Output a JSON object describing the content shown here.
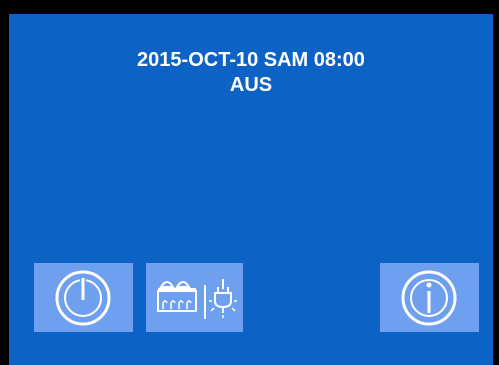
{
  "status": {
    "datetime": "2015-OCT-10 SAM 08:00",
    "state": "AUS"
  },
  "buttons": [
    {
      "name": "power-button",
      "icon": "power-icon"
    },
    {
      "name": "service-button",
      "icon": "fryer-and-plug-icon"
    },
    {
      "name": "info-button",
      "icon": "info-icon"
    }
  ],
  "colors": {
    "background": "#0d63c5",
    "button": "#6fa0ef",
    "text": "#ffffff",
    "frame": "#000000"
  }
}
